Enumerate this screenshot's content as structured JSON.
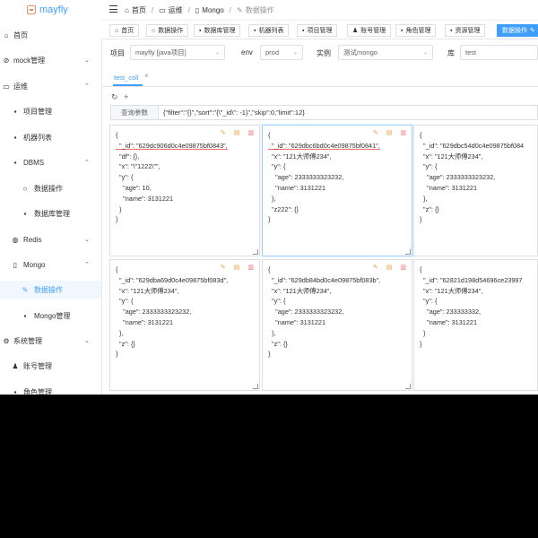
{
  "app": {
    "title": "mayfly"
  },
  "sidebar": {
    "items": [
      {
        "label": "首页",
        "icon": "home-icon",
        "arrow": ""
      },
      {
        "label": "mock管理",
        "icon": "link-icon",
        "arrow": "⌄"
      },
      {
        "label": "运维",
        "icon": "monitor-icon",
        "arrow": "⌃"
      },
      {
        "label": "项目管理",
        "icon": "grid-icon",
        "arrow": ""
      },
      {
        "label": "机器列表",
        "icon": "grid-icon",
        "arrow": ""
      },
      {
        "label": "DBMS",
        "icon": "grid-icon",
        "arrow": "⌃"
      },
      {
        "label": "数据操作",
        "icon": "search-icon",
        "arrow": ""
      },
      {
        "label": "数据库管理",
        "icon": "grid-icon",
        "arrow": ""
      },
      {
        "label": "Redis",
        "icon": "redis-icon",
        "arrow": "⌄"
      },
      {
        "label": "Mongo",
        "icon": "document-icon",
        "arrow": "⌃"
      },
      {
        "label": "数据操作",
        "icon": "edit-icon",
        "arrow": ""
      },
      {
        "label": "Mongo管理",
        "icon": "grid-icon",
        "arrow": ""
      },
      {
        "label": "系统管理",
        "icon": "gear-icon",
        "arrow": "⌄"
      },
      {
        "label": "账号管理",
        "icon": "user-icon",
        "arrow": ""
      },
      {
        "label": "角色管理",
        "icon": "grid-icon",
        "arrow": ""
      }
    ]
  },
  "header": {
    "breadcrumb": [
      "首页",
      "运维",
      "Mongo",
      "数据操作"
    ]
  },
  "tags": [
    {
      "label": "首页",
      "icon": "home-icon"
    },
    {
      "label": "数据操作",
      "icon": "search-icon"
    },
    {
      "label": "数据库管理",
      "icon": "grid-icon"
    },
    {
      "label": "机器列表",
      "icon": "grid-icon"
    },
    {
      "label": "项目管理",
      "icon": "grid-icon"
    },
    {
      "label": "账号管理",
      "icon": "user-icon"
    },
    {
      "label": "角色管理",
      "icon": "grid-icon"
    },
    {
      "label": "资源管理",
      "icon": "grid-icon"
    },
    {
      "label": "数据操作",
      "icon": "edit-icon"
    }
  ],
  "form": {
    "project_label": "项目",
    "project_value": "mayfly [java项目]",
    "env_label": "env",
    "env_value": "prod",
    "instance_label": "实例",
    "instance_value": "测试mongo",
    "db_label": "库",
    "db_value": "test"
  },
  "collection_tab": {
    "name": "test_coll",
    "close": "×"
  },
  "query": {
    "label": "查询参数",
    "value": "{\"filter\":\"{}\",\"sort\":\"{\\\"_id\\\": -1}\",\"skip\":0,\"limit\":12}"
  },
  "documents": [
    {
      "id": "629dc906d0c4e09875bf0843",
      "lines": [
        "{",
        "  \"_id\": \"629dc906d0c4e09875bf0843\",",
        "  \"df\": {},",
        "  \"x\": \"\\\"1222\\\"\",",
        "  \"y\": {",
        "    \"age\": 10,",
        "    \"name\": 3131221",
        "  }",
        "}"
      ]
    },
    {
      "id": "629dbc6bd0c4e09875bf0841",
      "lines": [
        "{",
        "  \"_id\": \"629dbc6bd0c4e09875bf0841\",",
        "  \"x\": \"121大师傅234\",",
        "  \"y\": {",
        "    \"age\": 2333333323232,",
        "    \"name\": 3131221",
        "  },",
        "  \"z222\": {}",
        "}"
      ]
    },
    {
      "id": "629dbc54d0c4e09875bf084",
      "lines": [
        "{",
        "  \"_id\": \"629dbc54d0c4e09875bf084",
        "  \"x\": \"121大师傅234\",",
        "  \"y\": {",
        "    \"age\": 2333333323232,",
        "    \"name\": 3131221",
        "  },",
        "  \"z\": {}",
        "}"
      ]
    },
    {
      "id": "629dba69d0c4e09875bf083d",
      "lines": [
        "{",
        "  \"_id\": \"629dba69d0c4e09875bf083d\",",
        "  \"x\": \"121大师傅234\",",
        "  \"y\": {",
        "    \"age\": 2333333323232,",
        "    \"name\": 3131221",
        "  },",
        "  \"z\": {}",
        "}"
      ]
    },
    {
      "id": "629db84bd0c4e09875bf083b",
      "lines": [
        "{",
        "  \"_id\": \"629db84bd0c4e09875bf083b\",",
        "  \"x\": \"121大师傅234\",",
        "  \"y\": {",
        "    \"age\": 2333333323232,",
        "    \"name\": 3131221",
        "  },",
        "  \"z\": {}",
        "}"
      ]
    },
    {
      "id": "62821d198d54696ce23997",
      "lines": [
        "{",
        "  \"_id\": \"62821d198d54696ce23997",
        "  \"x\": \"121大师傅234\",",
        "  \"y\": {",
        "    \"age\": 233333332,",
        "    \"name\": 3131221",
        "  }",
        "}"
      ]
    }
  ],
  "colors": {
    "accent": "#409eff",
    "warning": "#e6a23c",
    "danger": "#f56c6c"
  }
}
